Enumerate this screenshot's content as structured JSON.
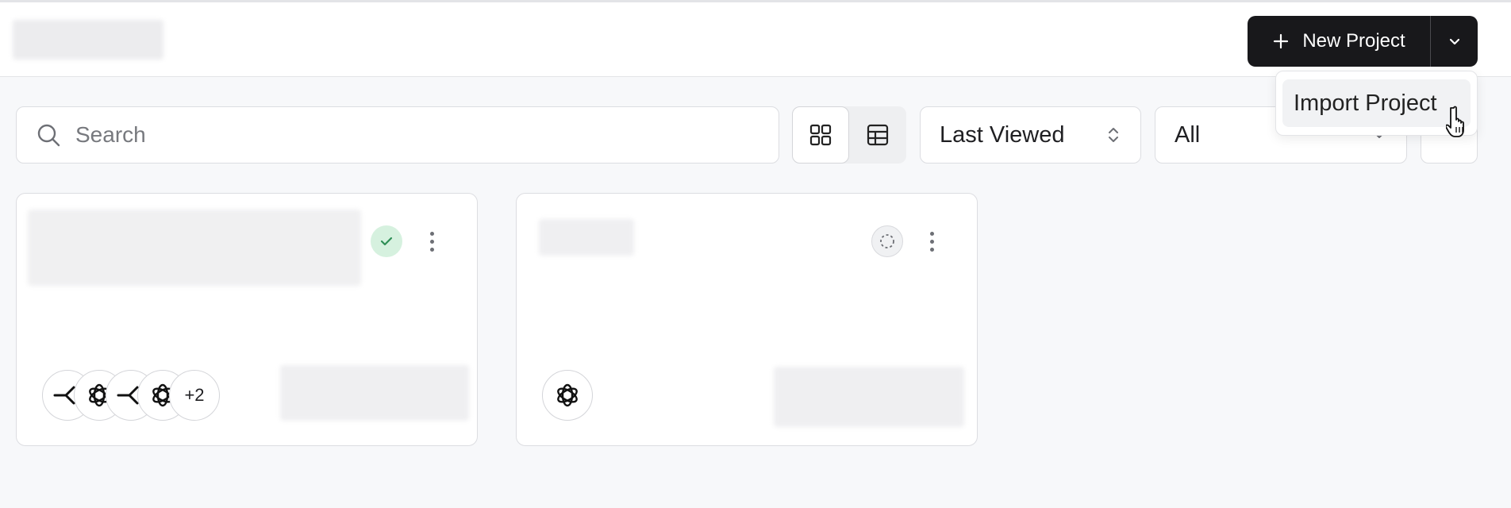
{
  "header": {
    "new_project_label": "New Project",
    "menu": {
      "import_label": "Import Project"
    }
  },
  "toolbar": {
    "search_placeholder": "Search",
    "sort": {
      "selected": "Last Viewed"
    },
    "filter": {
      "selected": "All"
    }
  },
  "cards": [
    {
      "status": "completed",
      "models": [
        "branch",
        "openai",
        "branch",
        "openai"
      ],
      "more_count": "+2"
    },
    {
      "status": "pending",
      "models": [
        "openai"
      ]
    }
  ],
  "colors": {
    "primary_button": "#18181b",
    "status_done_bg": "#d6f1df",
    "status_done_check": "#2f8f56"
  },
  "icons": [
    "plus-icon",
    "chevron-down-icon",
    "search-icon",
    "grid-view-icon",
    "table-view-icon",
    "sort-arrows-icon",
    "check-icon",
    "dashed-circle-icon",
    "openai-icon",
    "branch-icon",
    "pointer-hand-icon"
  ]
}
